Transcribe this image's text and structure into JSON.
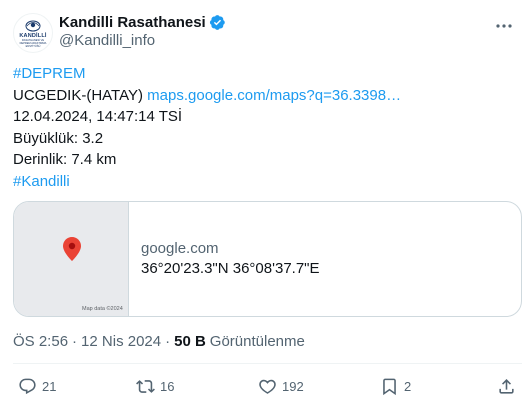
{
  "author": {
    "display_name": "Kandilli Rasathanesi",
    "handle": "@Kandilli_info",
    "verified": true,
    "avatar_logo_text": "KANDİLLİ",
    "avatar_logo_sub": "RASATHANESİ VE DEPREM ARAŞTIRMA ENSTİTÜSÜ"
  },
  "tweet": {
    "hashtag_top": "#DEPREM",
    "location_label": "UCGEDIK-(HATAY)",
    "location_link": "maps.google.com/maps?q=36.3398…",
    "datetime_line": "12.04.2024, 14:47:14 TSİ",
    "magnitude_line": "Büyüklük: 3.2",
    "depth_line": "Derinlik: 7.4 km",
    "hashtag_bottom": "#Kandilli"
  },
  "card": {
    "map_credit": "Map data ©2024",
    "domain": "google.com",
    "title": "36°20'23.3\"N 36°08'37.7\"E"
  },
  "meta": {
    "time": "ÖS 2:56",
    "separator": "·",
    "date": "12 Nis 2024",
    "views_count": "50 B",
    "views_label": "Görüntülenme"
  },
  "actions": {
    "reply_count": "21",
    "retweet_count": "16",
    "like_count": "192",
    "bookmark_count": "2"
  },
  "colors": {
    "link": "#1d9bf0",
    "verified_badge": "#1d9bf0",
    "map_pin": "#ea4335",
    "secondary_text": "#536471"
  }
}
